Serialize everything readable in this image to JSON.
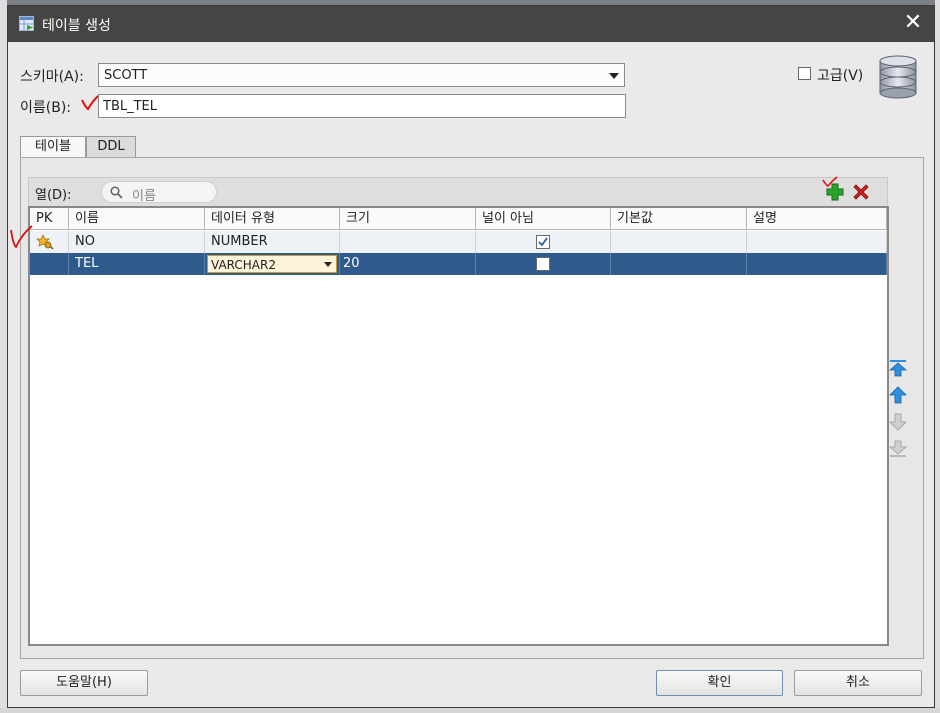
{
  "window": {
    "title": "테이블 생성",
    "close_glyph": "✕"
  },
  "form": {
    "schema_label": "스키마(A):",
    "schema_value": "SCOTT",
    "name_label": "이름(B):",
    "name_value": "TBL_TEL",
    "advanced_label": "고급(V)"
  },
  "tabs": [
    "테이블",
    "DDL"
  ],
  "columns_panel": {
    "columns_label": "열(D):",
    "search_placeholder": "이름"
  },
  "grid": {
    "headers": [
      "PK",
      "이름",
      "데이터 유형",
      "크기",
      "널이 아님",
      "기본값",
      "설명"
    ],
    "rows": [
      {
        "pk": true,
        "name": "NO",
        "type": "NUMBER",
        "size": "",
        "not_null": true,
        "default": "",
        "comment": ""
      },
      {
        "pk": false,
        "name": "TEL",
        "type": "VARCHAR2",
        "size": "20",
        "not_null": false,
        "default": "",
        "comment": ""
      }
    ]
  },
  "buttons": {
    "help": "도움말(H)",
    "ok": "확인",
    "cancel": "취소"
  },
  "colors": {
    "selected_row": "#2e5a8c",
    "title_bar": "#454545",
    "annotation_red": "#e01010",
    "add_green": "#2aa52a",
    "delete_red": "#d42020",
    "arrow_blue": "#2d8fe0"
  }
}
